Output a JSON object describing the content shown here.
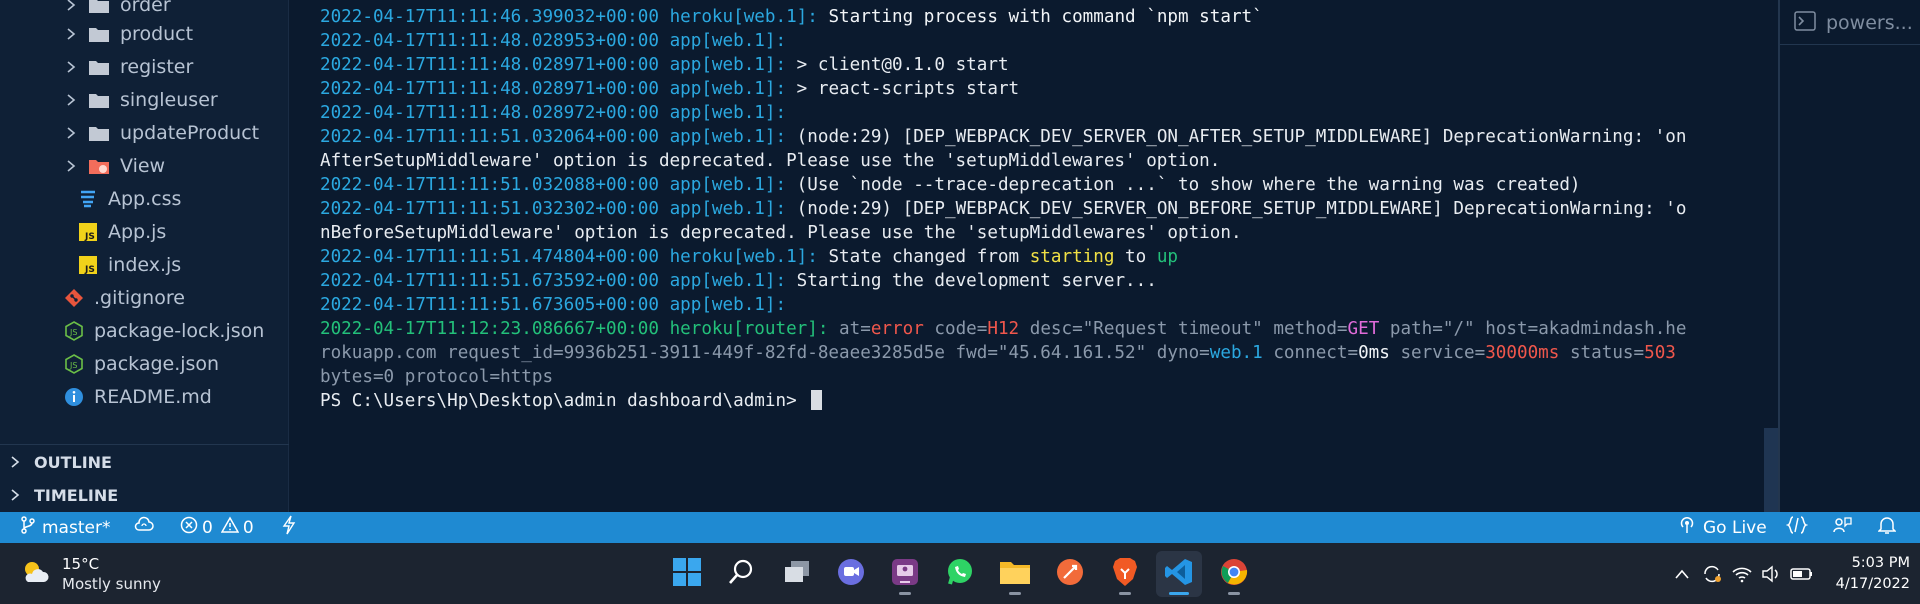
{
  "explorer": {
    "items": [
      {
        "label": "order",
        "type": "folder"
      },
      {
        "label": "product",
        "type": "folder"
      },
      {
        "label": "register",
        "type": "folder"
      },
      {
        "label": "singleuser",
        "type": "folder"
      },
      {
        "label": "updateProduct",
        "type": "folder"
      },
      {
        "label": "View",
        "type": "folder-special"
      },
      {
        "label": "App.css",
        "type": "css"
      },
      {
        "label": "App.js",
        "type": "js"
      },
      {
        "label": "index.js",
        "type": "js"
      },
      {
        "label": ".gitignore",
        "type": "git"
      },
      {
        "label": "package-lock.json",
        "type": "json"
      },
      {
        "label": "package.json",
        "type": "json"
      },
      {
        "label": "README.md",
        "type": "info"
      }
    ],
    "outline_label": "OUTLINE",
    "timeline_label": "TIMELINE"
  },
  "terminal": {
    "lines": [
      {
        "ts": "2022-04-17T11:11:46.399032+00:00",
        "src": "heroku[web.1]:",
        "msg": " Starting process with command `npm start`"
      },
      {
        "ts": "2022-04-17T11:11:48.028953+00:00",
        "src": "app[web.1]:",
        "msg": ""
      },
      {
        "ts": "2022-04-17T11:11:48.028971+00:00",
        "src": "app[web.1]:",
        "msg": " > client@0.1.0 start"
      },
      {
        "ts": "2022-04-17T11:11:48.028971+00:00",
        "src": "app[web.1]:",
        "msg": " > react-scripts start"
      },
      {
        "ts": "2022-04-17T11:11:48.028972+00:00",
        "src": "app[web.1]:",
        "msg": ""
      },
      {
        "ts": "2022-04-17T11:11:51.032064+00:00",
        "src": "app[web.1]:",
        "msg": " (node:29) [DEP_WEBPACK_DEV_SERVER_ON_AFTER_SETUP_MIDDLEWARE] DeprecationWarning: 'on"
      },
      {
        "ts": "",
        "src": "",
        "msg": "AfterSetupMiddleware' option is deprecated. Please use the 'setupMiddlewares' option."
      },
      {
        "ts": "2022-04-17T11:11:51.032088+00:00",
        "src": "app[web.1]:",
        "msg": " (Use `node --trace-deprecation ...` to show where the warning was created)"
      },
      {
        "ts": "2022-04-17T11:11:51.032302+00:00",
        "src": "app[web.1]:",
        "msg": " (node:29) [DEP_WEBPACK_DEV_SERVER_ON_BEFORE_SETUP_MIDDLEWARE] DeprecationWarning: 'o"
      },
      {
        "ts": "",
        "src": "",
        "msg": "nBeforeSetupMiddleware' option is deprecated. Please use the 'setupMiddlewares' option."
      },
      {
        "ts": "2022-04-17T11:11:51.474804+00:00",
        "src": "heroku[web.1]:",
        "msg": " State changed from "
      },
      {
        "ts": "2022-04-17T11:11:51.673592+00:00",
        "src": "app[web.1]:",
        "msg": " Starting the development server..."
      },
      {
        "ts": "2022-04-17T11:11:51.673605+00:00",
        "src": "app[web.1]:",
        "msg": ""
      }
    ],
    "state_from": "starting",
    "state_word_to": " to ",
    "state_to": "up",
    "router": {
      "ts": "2022-04-17T11:12:23.086667+00:00",
      "src": "heroku[router]:",
      "at_key": " at=",
      "at_val": "error",
      "code_key": " code=",
      "code_val": "H12",
      "desc": " desc=\"Request timeout\" method=",
      "method_val": "GET",
      "path_key": " path=",
      "path_val": "\"/\"",
      "host": " host=akadmindash.he",
      "line2_a": "rokuapp.com request_id=9936b251-3911-449f-82fd-8eaee3285d5e fwd=\"45.64.161.52\" dyno=",
      "dyno_val": "web.1",
      "connect_key": " connect=",
      "connect_val": "0ms",
      "service_key": " service=",
      "service_val": "30000ms",
      "status_key": " status=",
      "status_val": "503",
      "line3": "bytes=0 protocol=https"
    },
    "prompt": "PS C:\\Users\\Hp\\Desktop\\admin dashboard\\admin> "
  },
  "right_panel": {
    "tab_label": "powers..."
  },
  "statusbar": {
    "branch": "master*",
    "errors": "0",
    "warnings": "0",
    "go_live": "Go Live"
  },
  "taskbar": {
    "weather_temp": "15°C",
    "weather_desc": "Mostly sunny",
    "apps": [
      "windows-start",
      "search",
      "task-view",
      "teams-chat",
      "meet",
      "whatsapp",
      "file-explorer",
      "postman",
      "brave",
      "vscode",
      "chrome"
    ],
    "time": "5:03 PM",
    "date": "4/17/2022"
  },
  "colors": {
    "statusbar": "#1f8ad2",
    "timestamp": "#2ba8e0",
    "router_ts": "#23c07a",
    "error": "#f0574c"
  }
}
